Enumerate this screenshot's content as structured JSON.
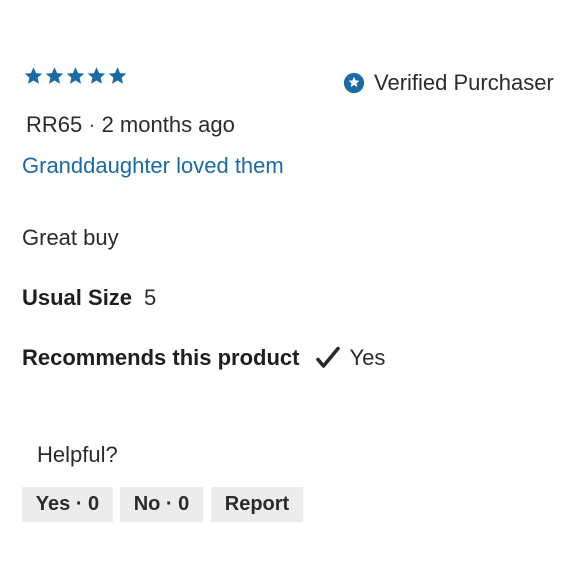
{
  "review": {
    "rating": {
      "value": 5,
      "max": 5
    },
    "verified_label": "Verified Purchaser",
    "author": "RR65",
    "separator": "·",
    "posted_ago": "2 months ago",
    "title": "Granddaughter loved them",
    "body": "Great buy",
    "usual_size": {
      "label": "Usual Size",
      "value": "5"
    },
    "recommends": {
      "label": "Recommends this product",
      "value": "Yes"
    }
  },
  "feedback": {
    "prompt": "Helpful?",
    "yes_label": "Yes · 0",
    "no_label": "No · 0",
    "report_label": "Report"
  },
  "colors": {
    "star": "#1a6aa6",
    "link": "#1a6aa6",
    "verified_icon": "#1a6aa6",
    "button_bg": "#ececec"
  },
  "icons": [
    "star-icon",
    "verified-badge-icon",
    "checkmark-icon"
  ]
}
